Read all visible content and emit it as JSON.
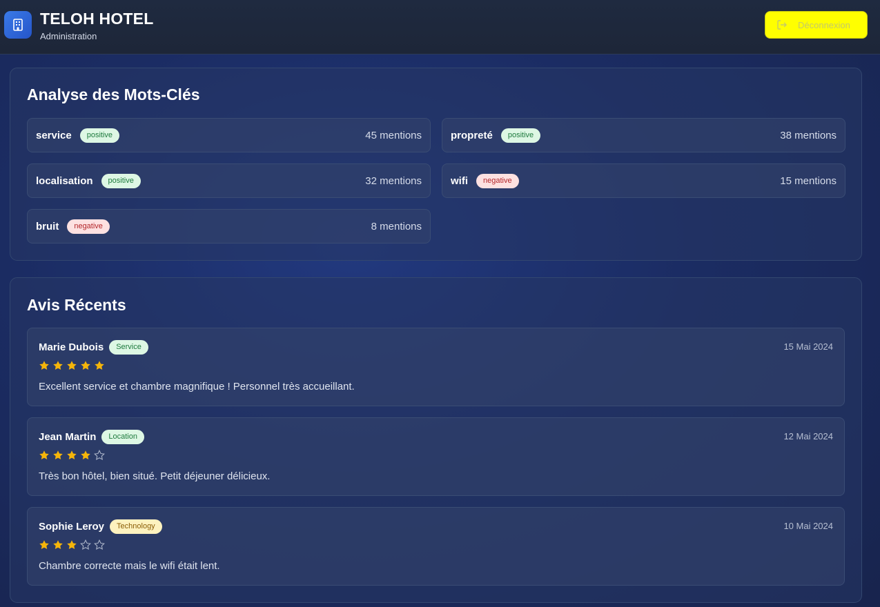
{
  "header": {
    "title": "TELOH HOTEL",
    "subtitle": "Administration",
    "logout_label": "Déconnexion",
    "logo_icon": "building-icon",
    "logout_icon": "logout-icon"
  },
  "keywords_section": {
    "title": "Analyse des Mots-Clés",
    "items": [
      {
        "name": "service",
        "sentiment": "positive",
        "mentions": "45 mentions"
      },
      {
        "name": "propreté",
        "sentiment": "positive",
        "mentions": "38 mentions"
      },
      {
        "name": "localisation",
        "sentiment": "positive",
        "mentions": "32 mentions"
      },
      {
        "name": "wifi",
        "sentiment": "negative",
        "mentions": "15 mentions"
      },
      {
        "name": "bruit",
        "sentiment": "negative",
        "mentions": "8 mentions"
      }
    ]
  },
  "reviews_section": {
    "title": "Avis Récents",
    "items": [
      {
        "author": "Marie Dubois",
        "category": "Service",
        "date": "15 Mai 2024",
        "rating": 5,
        "text": "Excellent service et chambre magnifique ! Personnel très accueillant."
      },
      {
        "author": "Jean Martin",
        "category": "Location",
        "date": "12 Mai 2024",
        "rating": 4,
        "text": "Très bon hôtel, bien situé. Petit déjeuner délicieux."
      },
      {
        "author": "Sophie Leroy",
        "category": "Technology",
        "date": "10 Mai 2024",
        "rating": 3,
        "text": "Chambre correcte mais le wifi était lent."
      }
    ]
  },
  "colors": {
    "accent": "#ffff00",
    "star_filled": "#f5b50a",
    "star_empty": "#aab3c7",
    "positive_bg": "#ddf7e4",
    "negative_bg": "#fde1e1"
  }
}
